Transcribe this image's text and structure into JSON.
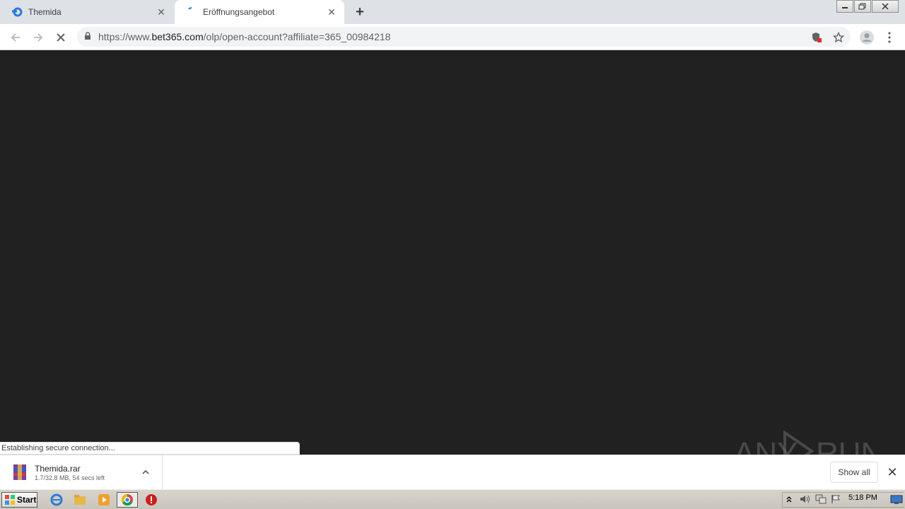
{
  "browser": {
    "tabs": [
      {
        "title": "Themida",
        "state": "inactive",
        "favicon": "blue-swirl-icon"
      },
      {
        "title": "Eröffnungsangebot",
        "state": "active",
        "favicon": "loading-spinner-icon"
      }
    ],
    "new_tab_icon": "plus-icon",
    "url": {
      "prefix": "https://www.",
      "host": "bet365.com",
      "path": "/olp/open-account?affiliate=365_00984218"
    },
    "status_text": "Establishing secure connection..."
  },
  "download_bar": {
    "item": {
      "name": "Themida.rar",
      "status": "1.7/32.8 MB, 54 secs left"
    },
    "show_all_label": "Show all"
  },
  "watermark": {
    "text": "ANY RUN"
  },
  "taskbar": {
    "start_label": "Start",
    "clock": "5:18 PM"
  },
  "colors": {
    "content_bg": "#212121",
    "titlebar_bg": "#dee1e6",
    "omnibox_bg": "#f1f3f4"
  }
}
